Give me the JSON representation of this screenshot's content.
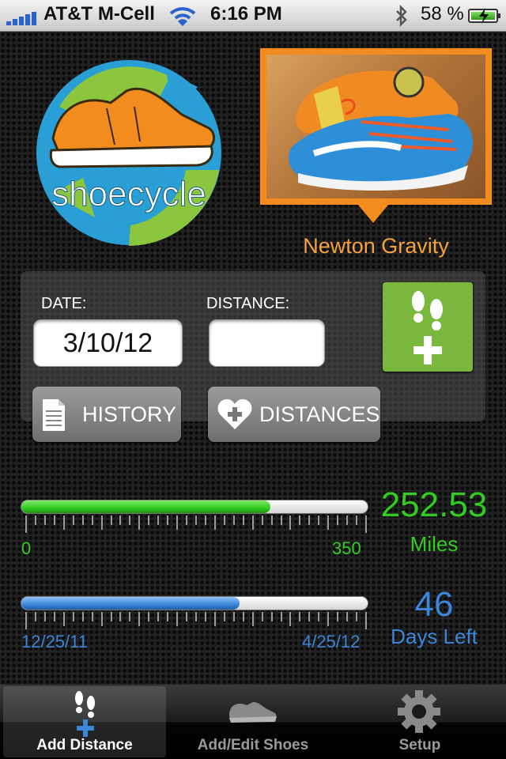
{
  "status_bar": {
    "carrier": "AT&T M-Cell",
    "time": "6:16 PM",
    "battery": "58 %",
    "battery_level": 0.58
  },
  "logo": {
    "text": "shoecycle"
  },
  "shoe": {
    "name": "Newton Gravity"
  },
  "form": {
    "date_label": "DATE:",
    "date_value": "3/10/12",
    "distance_label": "DISTANCE:",
    "distance_value": "",
    "history_label": "HISTORY",
    "distances_label": "DISTANCES"
  },
  "distance_progress": {
    "min": "0",
    "max": "350",
    "value": "252.53",
    "unit": "Miles",
    "fraction": 0.72,
    "color": "#33cc22"
  },
  "time_progress": {
    "start": "12/25/11",
    "end": "4/25/12",
    "value": "46",
    "unit": "Days Left",
    "fraction": 0.63,
    "color": "#3b86d8"
  },
  "tabs": [
    {
      "label": "Add Distance",
      "icon": "footsteps-plus-icon",
      "active": true
    },
    {
      "label": "Add/Edit Shoes",
      "icon": "shoe-icon",
      "active": false
    },
    {
      "label": "Setup",
      "icon": "gear-icon",
      "active": false
    }
  ]
}
